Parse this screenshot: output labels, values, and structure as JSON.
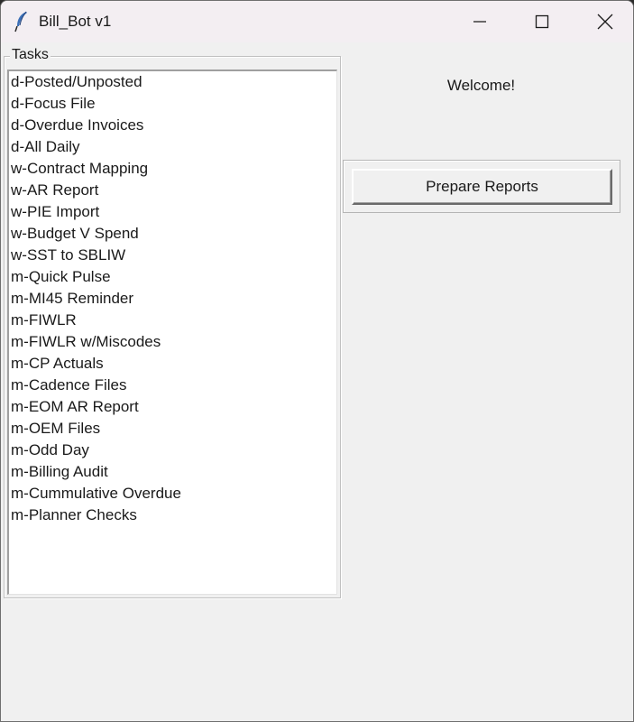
{
  "window": {
    "title": "Bill_Bot v1",
    "app_icon": "feather-icon",
    "controls": [
      "minimize-icon",
      "maximize-icon",
      "close-icon"
    ]
  },
  "tasks": {
    "label": "Tasks",
    "items": [
      "d-Posted/Unposted",
      "d-Focus File",
      "d-Overdue Invoices",
      "d-All Daily",
      "w-Contract Mapping",
      "w-AR Report",
      "w-PIE Import",
      "w-Budget V Spend",
      "w-SST to SBLIW",
      "m-Quick Pulse",
      "m-MI45 Reminder",
      "m-FIWLR",
      "m-FIWLR w/Miscodes",
      "m-CP Actuals",
      "m-Cadence Files",
      "m-EOM AR Report",
      "m-OEM Files",
      "m-Odd Day",
      "m-Billing Audit",
      "m-Cummulative Overdue",
      "m-Planner Checks"
    ]
  },
  "main": {
    "welcome_text": "Welcome!",
    "prepare_button_label": "Prepare Reports"
  },
  "colors": {
    "window_bg": "#f0f0f0",
    "titlebar_bg": "#f3eef2",
    "list_bg": "#ffffff",
    "text": "#1a1a1a"
  }
}
